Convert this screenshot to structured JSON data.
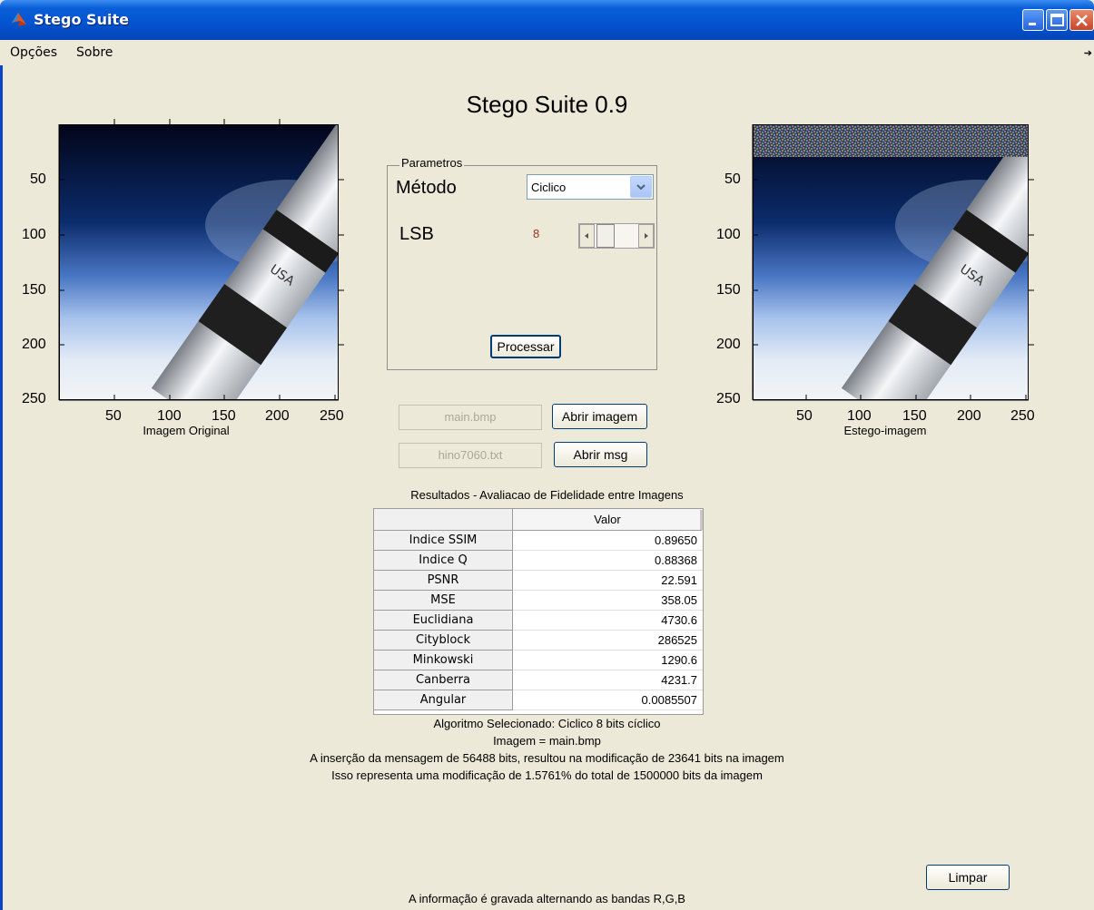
{
  "window": {
    "title": "Stego Suite"
  },
  "menu": {
    "items": [
      "Opções",
      "Sobre"
    ]
  },
  "app_title": "Stego Suite 0.9",
  "left_axes": {
    "xlabel": "Imagem Original",
    "yticks": [
      "50",
      "100",
      "150",
      "200",
      "250"
    ],
    "xticks": [
      "50",
      "100",
      "150",
      "200",
      "250"
    ]
  },
  "right_axes": {
    "xlabel": "Estego-imagem",
    "yticks": [
      "50",
      "100",
      "150",
      "200",
      "250"
    ],
    "xticks": [
      "50",
      "100",
      "150",
      "200",
      "250"
    ]
  },
  "panel": {
    "title": "Parametros",
    "metodo_label": "Método",
    "metodo_value": "Ciclico",
    "lsb_label": "LSB",
    "lsb_value": "8",
    "processar_label": "Processar"
  },
  "files": {
    "image_field": "main.bmp",
    "open_image_label": "Abrir imagem",
    "msg_field": "hino7060.txt",
    "open_msg_label": "Abrir msg"
  },
  "results": {
    "title": "Resultados - Avaliacao de Fidelidade entre Imagens",
    "column_header": "Valor",
    "rows": [
      {
        "name": "Indice SSIM",
        "value": "0.89650"
      },
      {
        "name": "Indice Q",
        "value": "0.88368"
      },
      {
        "name": "PSNR",
        "value": "22.591"
      },
      {
        "name": "MSE",
        "value": "358.05"
      },
      {
        "name": "Euclidiana",
        "value": "4730.6"
      },
      {
        "name": "Cityblock",
        "value": "286525"
      },
      {
        "name": "Minkowski",
        "value": "1290.6"
      },
      {
        "name": "Canberra",
        "value": "4231.7"
      },
      {
        "name": "Angular",
        "value": "0.0085507"
      }
    ]
  },
  "info": {
    "line1": "Algoritmo Selecionado: Ciclico 8 bits cíclico",
    "line2": "Imagem = main.bmp",
    "line3": "A inserção da mensagem de 56488 bits, resultou na modificação de  23641 bits na imagem",
    "line4": "Isso representa uma modificação de 1.5761% do total de 1500000 bits da imagem",
    "footer": "A informação é gravada alternando as bandas R,G,B"
  },
  "limpar_label": "Limpar",
  "colors": {
    "titlebar": "#0453d0",
    "background": "#ece9d8",
    "lsb_value": "#a03020"
  }
}
